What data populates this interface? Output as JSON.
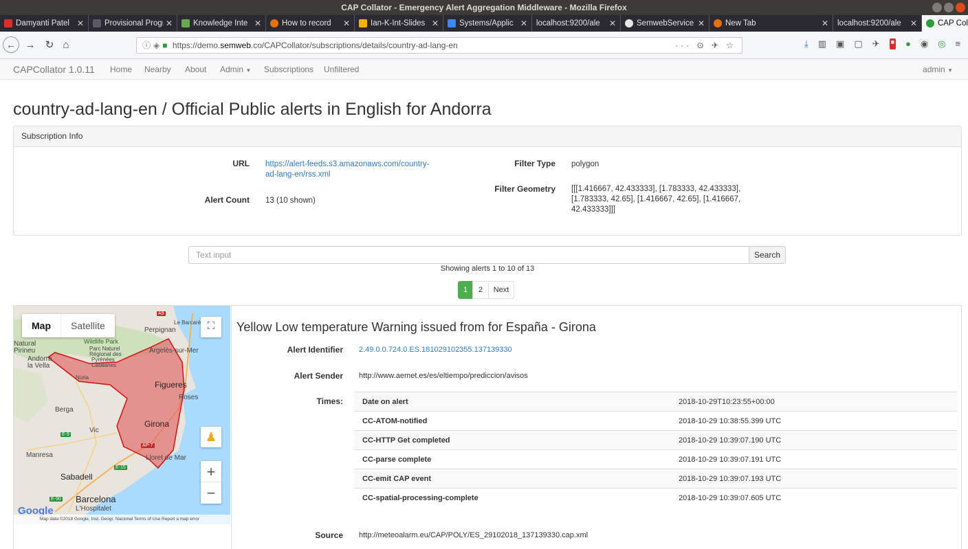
{
  "window": {
    "title": "CAP Collator - Emergency Alert Aggregation Middleware - Mozilla Firefox"
  },
  "tabs": [
    {
      "label": "Damyanti Patel",
      "favicon_color": "#d93025"
    },
    {
      "label": "Provisional Progra",
      "favicon_color": "#2b2a33"
    },
    {
      "label": "Knowledge Inte",
      "favicon_color": "#6aa84f"
    },
    {
      "label": "How to record",
      "favicon_color": "#e8710a"
    },
    {
      "label": "Ian-K-Int-Slides",
      "favicon_color": "#f4b400"
    },
    {
      "label": "Systems/Applic",
      "favicon_color": "#4285f4"
    },
    {
      "label": "localhost:9200/ale",
      "favicon_color": "#2b2a33"
    },
    {
      "label": "SemwebService",
      "favicon_color": "#e6e6e6"
    },
    {
      "label": "New Tab",
      "favicon_color": "#e8710a"
    },
    {
      "label": "localhost:9200/ale",
      "favicon_color": "#2b2a33"
    },
    {
      "label": "CAP Collator - E",
      "favicon_color": "#2e9e3c",
      "active": true
    }
  ],
  "urlbar": {
    "prefix": "https://demo.",
    "domain": "semweb",
    "suffix": ".co/CAPCollator/subscriptions/details/country-ad-lang-en",
    "right_icons": "··· ⊙ ✈ ☆"
  },
  "appnav": {
    "brand": "CAPCollator 1.0.11",
    "links": [
      "Home",
      "Nearby",
      "About",
      "Admin",
      "Subscriptions",
      "Unfiltered"
    ],
    "user": "admin"
  },
  "page": {
    "title": "country-ad-lang-en / Official Public alerts in English for Andorra"
  },
  "subscription": {
    "heading": "Subscription Info",
    "url_label": "URL",
    "url_line1": "https://alert-feeds.s3.amazonaws.com/country-",
    "url_line2": "ad-lang-en/rss.xml",
    "alert_count_label": "Alert Count",
    "alert_count": "13 (10 shown)",
    "filter_type_label": "Filter Type",
    "filter_type": "polygon",
    "filter_geometry_label": "Filter Geometry",
    "filter_geometry_line1": "[[[1.416667, 42.433333], [1.783333, 42.433333],",
    "filter_geometry_line2": "[1.783333, 42.65], [1.416667, 42.65], [1.416667,",
    "filter_geometry_line3": "42.433333]]]"
  },
  "search": {
    "placeholder": "Text input",
    "button": "Search",
    "showing": "Showing alerts 1 to 10 of 13"
  },
  "pager": {
    "page1": "1",
    "page2": "2",
    "next": "Next"
  },
  "map": {
    "type_map": "Map",
    "type_satellite": "Satellite",
    "attribution": "Map data ©2018 Google, Inst. Geogr. Nacional   Terms of Use   Report a map error",
    "logo": "Google",
    "labels": {
      "perpignan": "Perpignan",
      "le_barcares": "Le Barcarès",
      "wildlife_park": "Wildlife Park",
      "parc_naturel": "Parc Naturel",
      "regional_des": "Régional des",
      "pyrenees": "Pyrénées",
      "catalanes": "Catalanes",
      "argeles": "Argelès-sur-Mer",
      "natural": "Natural",
      "pirineu": "Pirineu",
      "andorra": "Andorra",
      "la_vella": "la Vella",
      "nuria": "Núria",
      "figueres": "Figueres",
      "roses": "Roses",
      "berga": "Berga",
      "girona": "Girona",
      "vic": "Vic",
      "manresa": "Manresa",
      "lloret": "Lloret de Mar",
      "sabadell": "Sabadell",
      "barcelona": "Barcelona",
      "hospitalet": "L'Hospitalet",
      "a9": "A9",
      "e9": "E-9",
      "ap7": "AP-7",
      "e15": "E-15",
      "e90": "E-90"
    }
  },
  "alert": {
    "title": "Yellow Low temperature Warning issued from for España - Girona",
    "identifier_label": "Alert Identifier",
    "identifier": "2.49.0.0.724.0.ES.181029102355.137139330",
    "sender_label": "Alert Sender",
    "sender": "http://www.aemet.es/es/eltiempo/prediccion/avisos",
    "times_label": "Times:",
    "times": [
      {
        "k": "Date on alert",
        "v": "2018-10-29T10:23:55+00:00"
      },
      {
        "k": "CC-ATOM-notified",
        "v": "2018-10-29 10:38:55.399 UTC"
      },
      {
        "k": "CC-HTTP Get completed",
        "v": "2018-10-29 10:39:07.190 UTC"
      },
      {
        "k": "CC-parse complete",
        "v": "2018-10-29 10:39:07.191 UTC"
      },
      {
        "k": "CC-emit CAP event",
        "v": "2018-10-29 10:39:07.193 UTC"
      },
      {
        "k": "CC-spatial-processing-complete",
        "v": "2018-10-29 10:39:07.605 UTC"
      }
    ],
    "source_label": "Source",
    "source": "http://meteoalarm.eu/CAP/POLY/ES_29102018_137139330.cap.xml"
  },
  "colors": {
    "link": "#337ab7",
    "pager_active": "#4cae4c",
    "polygon_fill": "#e06666",
    "polygon_stroke": "#d01010",
    "sea": "#aadaff"
  }
}
